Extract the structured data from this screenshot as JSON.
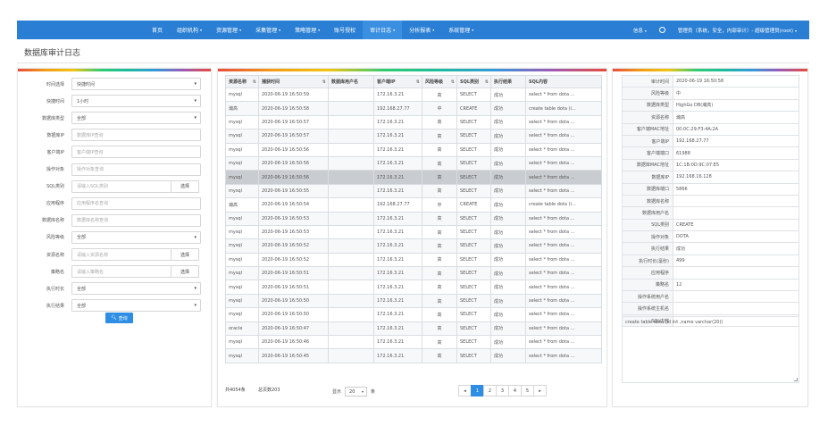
{
  "nav": {
    "items": [
      {
        "label": "首页",
        "caret": ""
      },
      {
        "label": "组织机构",
        "caret": "▾"
      },
      {
        "label": "资源管理",
        "caret": "▾"
      },
      {
        "label": "采集管理",
        "caret": "▾"
      },
      {
        "label": "策略管理",
        "caret": "▾"
      },
      {
        "label": "账号授权",
        "caret": ""
      },
      {
        "label": "审计日志",
        "caret": "▾"
      },
      {
        "label": "分析报表",
        "caret": "▾"
      },
      {
        "label": "系统管理",
        "caret": "▾"
      }
    ],
    "active_index": 6,
    "right_msg": "信息",
    "right_user": "管理员（系统，安全，内部审计）- 超级管理员(root)"
  },
  "page_title": "数据库审计日志",
  "filters": [
    {
      "label": "时间选择",
      "value": "快捷时间",
      "type": "select"
    },
    {
      "label": "快捷时间",
      "value": "1小时",
      "type": "select"
    },
    {
      "label": "数据库类型",
      "value": "全部",
      "type": "select"
    },
    {
      "label": "数据库IP",
      "placeholder": "数据库IP查询",
      "type": "input"
    },
    {
      "label": "客户端IP",
      "placeholder": "客户端IP查询",
      "type": "input"
    },
    {
      "label": "操作对象",
      "placeholder": "操作对象查询",
      "type": "input"
    },
    {
      "label": "SQL类别",
      "placeholder": "请输入SQL类别",
      "type": "input-btn",
      "button": "选择"
    },
    {
      "label": "应用程序",
      "placeholder": "应用程序名查询",
      "type": "input"
    },
    {
      "label": "数据库名称",
      "placeholder": "数据库名称查询",
      "type": "input"
    },
    {
      "label": "风险等级",
      "value": "全部",
      "type": "select"
    },
    {
      "label": "资源名称",
      "placeholder": "请输入资源名称",
      "type": "input-btn",
      "button": "选择"
    },
    {
      "label": "策略名",
      "placeholder": "请输入策略名",
      "type": "input-btn",
      "button": "选择"
    },
    {
      "label": "执行时长",
      "value": "全部",
      "type": "select"
    },
    {
      "label": "执行结果",
      "value": "全部",
      "type": "select"
    }
  ],
  "query_button": "查询",
  "table": {
    "columns": [
      "资源名称",
      "捕获时间",
      "数据库用户名",
      "客户端IP",
      "风险等级",
      "SQL类别",
      "执行结果",
      "SQL内容"
    ],
    "rows": [
      [
        "mysql",
        "2020-06-19 16:50:59",
        "",
        "172.16.3.21",
        "高",
        "SELECT",
        "成功",
        "select * from dota ..."
      ],
      [
        "瀚高",
        "2020-06-19 16:50:58",
        "",
        "192.168.27.77",
        "中",
        "CREATE",
        "成功",
        "create table dota (i..."
      ],
      [
        "mysql",
        "2020-06-19 16:50:57",
        "",
        "172.16.3.21",
        "高",
        "SELECT",
        "成功",
        "select * from dota ..."
      ],
      [
        "mysql",
        "2020-06-19 16:50:57",
        "",
        "172.16.3.21",
        "高",
        "SELECT",
        "成功",
        "select * from dota ..."
      ],
      [
        "mysql",
        "2020-06-19 16:50:56",
        "",
        "172.16.3.21",
        "高",
        "SELECT",
        "成功",
        "select * from dota ..."
      ],
      [
        "mysql",
        "2020-06-19 16:50:56",
        "",
        "172.16.3.21",
        "高",
        "SELECT",
        "成功",
        "select * from dota ..."
      ],
      [
        "mysql",
        "2020-06-19 16:50:56",
        "",
        "172.16.3.21",
        "高",
        "SELECT",
        "成功",
        "select * from dota ..."
      ],
      [
        "mysql",
        "2020-06-19 16:50:55",
        "",
        "172.16.3.21",
        "高",
        "SELECT",
        "成功",
        "select * from dota ..."
      ],
      [
        "瀚高",
        "2020-06-19 16:50:54",
        "",
        "192.168.27.77",
        "中",
        "CREATE",
        "成功",
        "create table dota (i..."
      ],
      [
        "mysql",
        "2020-06-19 16:50:53",
        "",
        "172.16.3.21",
        "高",
        "SELECT",
        "成功",
        "select * from dota ..."
      ],
      [
        "mysql",
        "2020-06-19 16:50:53",
        "",
        "172.16.3.21",
        "高",
        "SELECT",
        "成功",
        "select * from dota ..."
      ],
      [
        "mysql",
        "2020-06-19 16:50:52",
        "",
        "172.16.3.21",
        "高",
        "SELECT",
        "成功",
        "select * from dota ..."
      ],
      [
        "mysql",
        "2020-06-19 16:50:52",
        "",
        "172.16.3.21",
        "高",
        "SELECT",
        "成功",
        "select * from dota ..."
      ],
      [
        "mysql",
        "2020-06-19 16:50:51",
        "",
        "172.16.3.21",
        "高",
        "SELECT",
        "成功",
        "select * from dota ..."
      ],
      [
        "mysql",
        "2020-06-19 16:50:51",
        "",
        "172.16.3.21",
        "高",
        "SELECT",
        "成功",
        "select * from dota ..."
      ],
      [
        "mysql",
        "2020-06-19 16:50:50",
        "",
        "172.16.3.21",
        "高",
        "SELECT",
        "成功",
        "select * from dota ..."
      ],
      [
        "mysql",
        "2020-06-19 16:50:50",
        "",
        "172.16.3.21",
        "高",
        "SELECT",
        "成功",
        "select * from dota ..."
      ],
      [
        "oracle",
        "2020-06-19 16:50:47",
        "",
        "172.16.3.21",
        "高",
        "SELECT",
        "成功",
        "select * from dota ..."
      ],
      [
        "mysql",
        "2020-06-19 16:50:46",
        "",
        "172.16.3.21",
        "高",
        "SELECT",
        "成功",
        "select * from dota ..."
      ],
      [
        "mysql",
        "2020-06-19 16:50:45",
        "",
        "172.16.3.21",
        "高",
        "SELECT",
        "成功",
        "select * from dota ..."
      ]
    ],
    "selected_row": 6
  },
  "footer": {
    "total": "共4054条",
    "pages": "总页数203",
    "show_label": "显示",
    "page_size": "20",
    "unit": "条"
  },
  "pagination": {
    "prev": "◂",
    "pages": [
      "1",
      "2",
      "3",
      "4",
      "5"
    ],
    "next": "▸",
    "current": "1"
  },
  "detail": {
    "rows": [
      [
        "审计时间",
        "2020-06-19 16:50:58"
      ],
      [
        "风险等级",
        "中"
      ],
      [
        "数据库类型",
        "HighGo DB(瀚高)"
      ],
      [
        "资源名称",
        "瀚高"
      ],
      [
        "客户端MAC地址",
        "00:0C:29:F3:4A:2A"
      ],
      [
        "客户端IP",
        "192.168.27.77"
      ],
      [
        "客户端端口",
        "61988"
      ],
      [
        "数据库MAC地址",
        "1C:1B:0D:9C:07:E5"
      ],
      [
        "数据库IP",
        "192.168.16.128"
      ],
      [
        "数据库端口",
        "5866"
      ],
      [
        "数据库名称",
        ""
      ],
      [
        "数据库用户名",
        ""
      ],
      [
        "SQL类别",
        "CREATE"
      ],
      [
        "操作对象",
        "DOTA"
      ],
      [
        "执行结果",
        "成功"
      ],
      [
        "执行时长(毫秒)",
        "499"
      ],
      [
        "应用程序",
        ""
      ],
      [
        "策略名",
        "12"
      ],
      [
        "操作系统用户名",
        ""
      ],
      [
        "操作系统主机名",
        ""
      ],
      [
        "SQL内容",
        ""
      ]
    ],
    "sql": "create table dota (id int ,name varchar(20))"
  },
  "colors": {
    "nav": "#2a7fd4",
    "primary": "#2d8ee3",
    "risk_high": "#e53935",
    "risk_mid": "#f0a35a",
    "selected_row": "#c9ccd1"
  }
}
